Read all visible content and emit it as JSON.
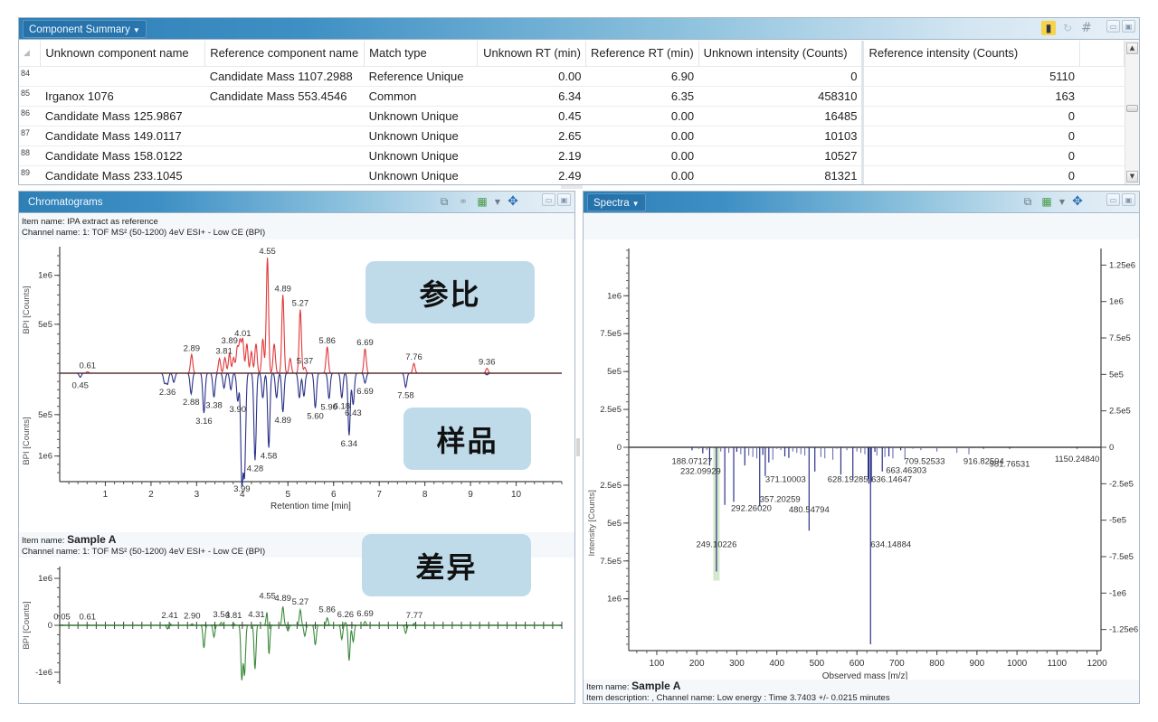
{
  "component_summary": {
    "title": "Component Summary",
    "icons": [
      "bar-chart-icon",
      "refresh-icon",
      "grid-hash-icon"
    ],
    "columns": [
      "Unknown component name",
      "Reference component name",
      "Match type",
      "Unknown RT (min)",
      "Reference RT (min)",
      "Unknown intensity (Counts)",
      "Reference intensity (Counts)"
    ],
    "rows": [
      {
        "num": "84",
        "unknown_name": "",
        "reference_name": "Candidate Mass 1107.2988",
        "match_type": "Reference Unique",
        "unknown_rt": "0.00",
        "reference_rt": "6.90",
        "unknown_intensity": "0",
        "reference_intensity": "5110"
      },
      {
        "num": "85",
        "unknown_name": "Irganox 1076",
        "reference_name": "Candidate Mass 553.4546",
        "match_type": "Common",
        "unknown_rt": "6.34",
        "reference_rt": "6.35",
        "unknown_intensity": "458310",
        "reference_intensity": "163"
      },
      {
        "num": "86",
        "unknown_name": "Candidate Mass 125.9867",
        "reference_name": "",
        "match_type": "Unknown Unique",
        "unknown_rt": "0.45",
        "reference_rt": "0.00",
        "unknown_intensity": "16485",
        "reference_intensity": "0"
      },
      {
        "num": "87",
        "unknown_name": "Candidate Mass 149.0117",
        "reference_name": "",
        "match_type": "Unknown Unique",
        "unknown_rt": "2.65",
        "reference_rt": "0.00",
        "unknown_intensity": "10103",
        "reference_intensity": "0"
      },
      {
        "num": "88",
        "unknown_name": "Candidate Mass 158.0122",
        "reference_name": "",
        "match_type": "Unknown Unique",
        "unknown_rt": "2.19",
        "reference_rt": "0.00",
        "unknown_intensity": "10527",
        "reference_intensity": "0"
      },
      {
        "num": "89",
        "unknown_name": "Candidate Mass 233.1045",
        "reference_name": "",
        "match_type": "Unknown Unique",
        "unknown_rt": "2.49",
        "reference_rt": "0.00",
        "unknown_intensity": "81321",
        "reference_intensity": "0"
      }
    ]
  },
  "chromatograms": {
    "title": "Chromatograms",
    "top_item_line": "Item name: IPA extract as reference",
    "top_channel_line": "Channel name: 1: TOF MS² (50-1200) 4eV ESI+ - Low CE (BPI)",
    "bottom_item_label": "Item name:",
    "bottom_item_value": "Sample A",
    "bottom_channel_line": "Channel name: 1: TOF MS² (50-1200) 4eV ESI+ - Low CE (BPI)",
    "callouts": {
      "reference": "参比",
      "sample": "样品",
      "difference": "差异"
    }
  },
  "spectra": {
    "title": "Spectra",
    "item_label": "Item name:",
    "item_value": "Sample A",
    "description_line": "Item description: , Channel name: Low energy : Time 3.7403 +/- 0.0215 minutes"
  },
  "chart_data": [
    {
      "id": "mirror-chromatogram",
      "type": "line",
      "xlabel": "Retention time [min]",
      "ylabel": "BPI [Counts]",
      "xlim": [
        0,
        11
      ],
      "x_ticks": [
        "1",
        "2",
        "3",
        "4",
        "5",
        "6",
        "7",
        "8",
        "9",
        "10"
      ],
      "y_ticks_top": [
        "1e6",
        "5e5"
      ],
      "y_ticks_bottom": [
        "5e5",
        "1e6"
      ],
      "ylim_top": [
        0,
        1200000
      ],
      "ylim_bottom": [
        0,
        1200000
      ],
      "series": [
        {
          "name": "Reference (IPA extract)",
          "color": "#e0383a",
          "direction": "up",
          "peaks": [
            [
              0.61,
              15000
            ],
            [
              2.89,
              190000
            ],
            [
              3.5,
              150000
            ],
            [
              3.62,
              160000
            ],
            [
              3.72,
              200000
            ],
            [
              3.81,
              160000
            ],
            [
              3.89,
              260000
            ],
            [
              3.95,
              320000
            ],
            [
              4.01,
              340000
            ],
            [
              4.1,
              300000
            ],
            [
              4.2,
              220000
            ],
            [
              4.3,
              300000
            ],
            [
              4.45,
              350000
            ],
            [
              4.55,
              1180000
            ],
            [
              4.7,
              300000
            ],
            [
              4.89,
              800000
            ],
            [
              5.05,
              150000
            ],
            [
              5.27,
              650000
            ],
            [
              5.37,
              60000
            ],
            [
              5.86,
              270000
            ],
            [
              6.69,
              250000
            ],
            [
              7.76,
              100000
            ],
            [
              9.36,
              50000
            ]
          ],
          "labels": [
            [
              "0.61",
              0.61,
              15000
            ],
            [
              "2.89",
              2.89,
              190000
            ],
            [
              "3.81",
              3.6,
              160000
            ],
            [
              "3.89",
              3.72,
              270000
            ],
            [
              "4.01",
              4.01,
              340000
            ],
            [
              "4.55",
              4.55,
              1180000
            ],
            [
              "4.89",
              4.89,
              800000
            ],
            [
              "5.27",
              5.27,
              650000
            ],
            [
              "5.37",
              5.37,
              60000
            ],
            [
              "5.86",
              5.86,
              270000
            ],
            [
              "6.69",
              6.69,
              250000
            ],
            [
              "7.76",
              7.76,
              100000
            ],
            [
              "9.36",
              9.36,
              50000
            ]
          ]
        },
        {
          "name": "Sample A",
          "color": "#2a3188",
          "direction": "down",
          "peaks": [
            [
              0.45,
              50000
            ],
            [
              2.3,
              120000
            ],
            [
              2.36,
              130000
            ],
            [
              2.5,
              110000
            ],
            [
              2.88,
              250000
            ],
            [
              3.16,
              480000
            ],
            [
              3.38,
              290000
            ],
            [
              3.6,
              180000
            ],
            [
              3.75,
              200000
            ],
            [
              3.9,
              340000
            ],
            [
              3.99,
              1300000
            ],
            [
              4.05,
              1200000
            ],
            [
              4.28,
              1050000
            ],
            [
              4.45,
              300000
            ],
            [
              4.58,
              900000
            ],
            [
              4.75,
              300000
            ],
            [
              4.89,
              470000
            ],
            [
              5.25,
              300000
            ],
            [
              5.35,
              280000
            ],
            [
              5.6,
              420000
            ],
            [
              5.9,
              310000
            ],
            [
              6.18,
              300000
            ],
            [
              6.34,
              750000
            ],
            [
              6.43,
              380000
            ],
            [
              6.69,
              120000
            ],
            [
              7.58,
              170000
            ],
            [
              9.36,
              20000
            ]
          ],
          "labels": [
            [
              "0.45",
              0.45,
              50000
            ],
            [
              "2.36",
              2.36,
              130000
            ],
            [
              "2.88",
              2.88,
              250000
            ],
            [
              "3.16",
              3.16,
              480000
            ],
            [
              "3.38",
              3.38,
              290000
            ],
            [
              "3.90",
              3.9,
              340000
            ],
            [
              "3.99",
              3.99,
              1300000
            ],
            [
              "4.28",
              4.28,
              1050000
            ],
            [
              "4.58",
              4.58,
              900000
            ],
            [
              "4.89",
              4.89,
              470000
            ],
            [
              "5.60",
              5.6,
              420000
            ],
            [
              "5.90",
              5.9,
              310000
            ],
            [
              "6.18",
              6.18,
              300000
            ],
            [
              "6.34",
              6.34,
              750000
            ],
            [
              "6.43",
              6.43,
              380000
            ],
            [
              "6.69",
              6.69,
              120000
            ],
            [
              "7.58",
              7.58,
              170000
            ]
          ]
        }
      ]
    },
    {
      "id": "difference-chromatogram",
      "type": "line",
      "xlabel": "",
      "ylabel": "BPI [Counts]",
      "xlim": [
        0,
        11
      ],
      "ylim": [
        -1250000,
        1250000
      ],
      "y_ticks": [
        "1e6",
        "0",
        "-1e6"
      ],
      "series": [
        {
          "name": "Difference",
          "color": "#3a8a3a",
          "peaks": [
            [
              0.05,
              10000
            ],
            [
              0.61,
              10000
            ],
            [
              2.36,
              -80000
            ],
            [
              2.41,
              40000
            ],
            [
              2.9,
              30000
            ],
            [
              3.16,
              -480000
            ],
            [
              3.38,
              -250000
            ],
            [
              3.54,
              60000
            ],
            [
              3.81,
              40000
            ],
            [
              3.99,
              -1150000
            ],
            [
              4.05,
              -1050000
            ],
            [
              4.28,
              -950000
            ],
            [
              4.31,
              60000
            ],
            [
              4.55,
              450000
            ],
            [
              4.58,
              -750000
            ],
            [
              4.89,
              400000
            ],
            [
              5.0,
              -120000
            ],
            [
              5.27,
              330000
            ],
            [
              5.37,
              -230000
            ],
            [
              5.6,
              -420000
            ],
            [
              5.86,
              160000
            ],
            [
              6.18,
              -300000
            ],
            [
              6.26,
              60000
            ],
            [
              6.34,
              -750000
            ],
            [
              6.43,
              -350000
            ],
            [
              6.69,
              80000
            ],
            [
              7.58,
              -170000
            ],
            [
              7.77,
              40000
            ]
          ],
          "labels": [
            [
              "0.05",
              0.05,
              10000
            ],
            [
              "0.61",
              0.61,
              10000
            ],
            [
              "2.41",
              2.41,
              40000
            ],
            [
              "2.90",
              2.9,
              30000
            ],
            [
              "3.54",
              3.54,
              60000
            ],
            [
              "3.81",
              3.81,
              40000
            ],
            [
              "4.31",
              4.31,
              60000
            ],
            [
              "4.55",
              4.55,
              450000
            ],
            [
              "4.89",
              4.89,
              400000
            ],
            [
              "5.27",
              5.27,
              330000
            ],
            [
              "5.86",
              5.86,
              160000
            ],
            [
              "6.26",
              6.26,
              60000
            ],
            [
              "6.69",
              6.69,
              80000
            ],
            [
              "7.77",
              7.77,
              40000
            ]
          ]
        }
      ]
    },
    {
      "id": "mirror-spectrum",
      "type": "bar",
      "xlabel": "Observed mass [m/z]",
      "ylabel": "Intensity [Counts]",
      "xlim": [
        30,
        1210
      ],
      "x_ticks": [
        "100",
        "200",
        "300",
        "400",
        "500",
        "600",
        "700",
        "800",
        "900",
        "1000",
        "1100",
        "1200"
      ],
      "y_ticks_left": [
        "1e6",
        "7.5e5",
        "5e5",
        "2.5e5",
        "0",
        "2.5e5",
        "5e5",
        "7.5e5",
        "1e6"
      ],
      "y_ticks_right": [
        "1.25e6",
        "1e6",
        "7.5e5",
        "5e5",
        "2.5e5",
        "0",
        "-2.5e5",
        "-5e5",
        "-7.5e5",
        "-1e6",
        "-1.25e6"
      ],
      "ylim": [
        -1300000,
        1300000
      ],
      "highlight_range": [
        241,
        257
      ],
      "peaks": [
        [
          188.07127,
          -20000
        ],
        [
          215,
          -40000
        ],
        [
          232.09929,
          -120000
        ],
        [
          249.10226,
          -820000
        ],
        [
          270,
          -380000
        ],
        [
          292.2602,
          -360000
        ],
        [
          300,
          -30000
        ],
        [
          320,
          -120000
        ],
        [
          357.20259,
          -390000
        ],
        [
          365,
          -50000
        ],
        [
          371.10003,
          -190000
        ],
        [
          380,
          -100000
        ],
        [
          420,
          -60000
        ],
        [
          430,
          -70000
        ],
        [
          480.54794,
          -550000
        ],
        [
          495,
          -160000
        ],
        [
          560,
          -180000
        ],
        [
          590,
          -210000
        ],
        [
          628.19285,
          -210000
        ],
        [
          630,
          -240000
        ],
        [
          634.14884,
          -1300000
        ],
        [
          636.14647,
          -230000
        ],
        [
          645,
          -30000
        ],
        [
          663.46303,
          -160000
        ],
        [
          680,
          -60000
        ],
        [
          709.52533,
          -20000
        ],
        [
          916.82504,
          -10000
        ],
        [
          981.76531,
          -10000
        ],
        [
          1150.2484,
          -10000
        ]
      ],
      "labels": [
        "188.07127",
        "232.09929",
        "249.10226",
        "292.26020",
        "357.20259",
        "371.10003",
        "480.54794",
        "628.19285",
        "634.14884",
        "636.14647",
        "663.46303",
        "709.52533",
        "916.82504",
        "981.76531",
        "1150.24840"
      ]
    }
  ]
}
